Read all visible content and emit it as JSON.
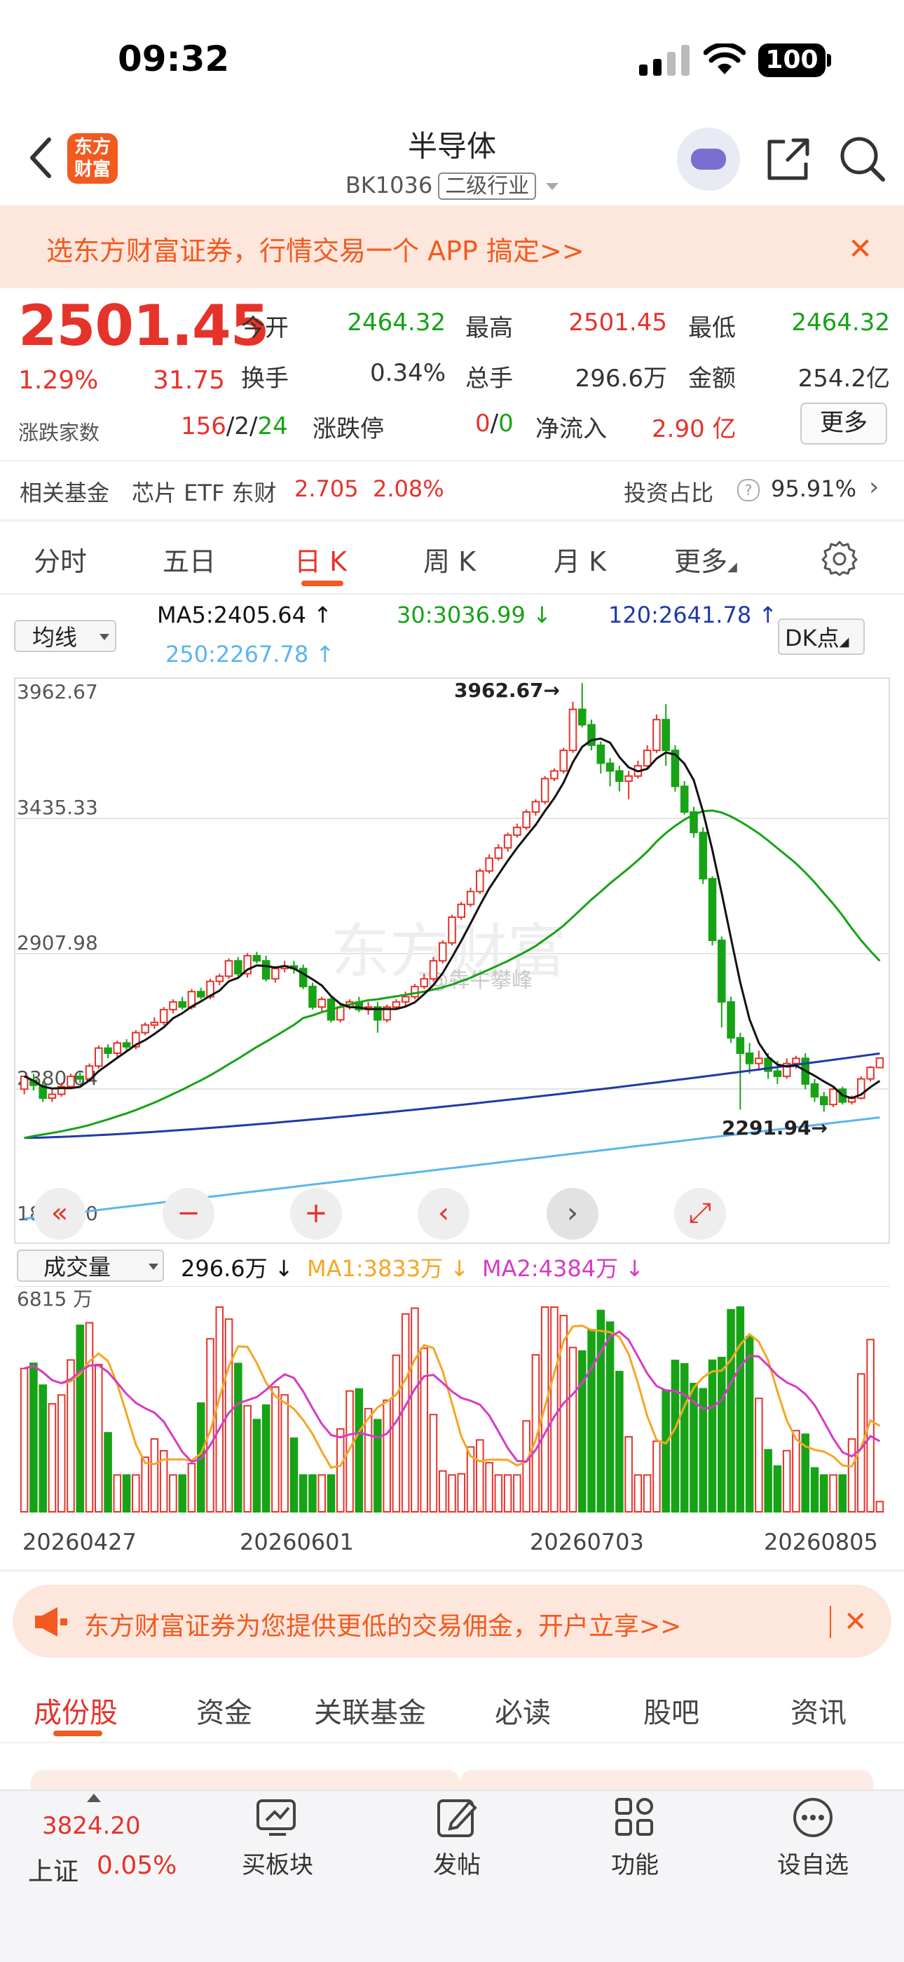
{
  "status_bar": {
    "time": "09:32",
    "battery": "100"
  },
  "header": {
    "title": "半导体",
    "code": "BK1036",
    "tag": "二级行业",
    "logo_text": "东方财富"
  },
  "promo": {
    "text": "选东方财富证券，行情交易一个 APP 搞定>>"
  },
  "quote": {
    "price": "2501.45",
    "change_pct": "1.29%",
    "change": "31.75",
    "open_label": "今开",
    "open": "2464.32",
    "high_label": "最高",
    "high": "2501.45",
    "low_label": "最低",
    "low": "2464.32",
    "turnover_label": "换手",
    "turnover": "0.34%",
    "volume_label": "总手",
    "volume": "296.6万",
    "amount_label": "金额",
    "amount": "254.2亿",
    "breadth_label": "涨跌家数",
    "breadth_up": "156",
    "breadth_flat": "2",
    "breadth_down": "24",
    "limit_label": "涨跌停",
    "limit_up": "0",
    "limit_down": "0",
    "inflow_label": "净流入",
    "inflow": "2.90 亿",
    "more": "更多"
  },
  "fund": {
    "label": "相关基金",
    "name": "芯片 ETF 东财",
    "price": "2.705",
    "pct": "2.08%",
    "ratio_label": "投资占比",
    "ratio": "95.91%"
  },
  "period_tabs": [
    "分时",
    "五日",
    "日 K",
    "周 K",
    "月 K",
    "更多"
  ],
  "ma": {
    "select": "均线",
    "ma5": "MA5:2405.64",
    "ma30": "30:3036.99",
    "ma120": "120:2641.78",
    "ma250": "250:2267.78",
    "dk": "DK点"
  },
  "kchart": {
    "axis_labels": [
      "3962.67",
      "3435.33",
      "2907.98",
      "2380.64",
      "1853.30"
    ],
    "max_label": "3962.67→",
    "min_label": "2291.94→",
    "watermark": "东方财富",
    "weibo_mark": "@犇牛攀峰",
    "controls": [
      "«",
      "−",
      "+",
      "‹",
      "›",
      "⤢"
    ]
  },
  "volume": {
    "select": "成交量",
    "vol": "296.6万",
    "ma1": "MA1:3833万",
    "ma2": "MA2:4384万",
    "top_label": "6815 万",
    "dates": [
      "20260427",
      "20260601",
      "20260703",
      "20260805"
    ]
  },
  "ad": {
    "text": "东方财富证券为您提供更低的交易佣金，开户立享>>"
  },
  "bottom_tabs": [
    "成份股",
    "资金",
    "关联基金",
    "必读",
    "股吧",
    "资讯"
  ],
  "nav": {
    "index_price": "3824.20",
    "index_name": "上证",
    "index_pct": "0.05%",
    "items": [
      "买板块",
      "发帖",
      "功能",
      "设自选"
    ]
  },
  "colors": {
    "up": "#e5332a",
    "down": "#16a316",
    "accent": "#f25a1f"
  },
  "chart_data": {
    "type": "candlestick",
    "dates_shown": [
      "20260427",
      "20260601",
      "20260703",
      "20260805"
    ],
    "ylim": [
      1853.3,
      3962.67
    ],
    "candles": [
      [
        2380,
        2430,
        2360,
        2415
      ],
      [
        2415,
        2395,
        2440,
        2375
      ],
      [
        2395,
        2345,
        2410,
        2330
      ],
      [
        2345,
        2360,
        2380,
        2330
      ],
      [
        2360,
        2390,
        2405,
        2350
      ],
      [
        2390,
        2430,
        2440,
        2380
      ],
      [
        2430,
        2420,
        2445,
        2405
      ],
      [
        2420,
        2470,
        2480,
        2410
      ],
      [
        2470,
        2540,
        2550,
        2460
      ],
      [
        2540,
        2520,
        2555,
        2500
      ],
      [
        2520,
        2560,
        2570,
        2505
      ],
      [
        2560,
        2545,
        2575,
        2530
      ],
      [
        2545,
        2600,
        2610,
        2535
      ],
      [
        2600,
        2630,
        2640,
        2590
      ],
      [
        2630,
        2640,
        2660,
        2615
      ],
      [
        2640,
        2690,
        2700,
        2630
      ],
      [
        2690,
        2720,
        2730,
        2675
      ],
      [
        2720,
        2700,
        2740,
        2690
      ],
      [
        2700,
        2760,
        2770,
        2690
      ],
      [
        2760,
        2740,
        2775,
        2730
      ],
      [
        2740,
        2800,
        2810,
        2730
      ],
      [
        2800,
        2820,
        2830,
        2785
      ],
      [
        2820,
        2880,
        2890,
        2810
      ],
      [
        2880,
        2830,
        2895,
        2820
      ],
      [
        2830,
        2900,
        2910,
        2815
      ],
      [
        2900,
        2880,
        2915,
        2870
      ],
      [
        2880,
        2810,
        2900,
        2800
      ],
      [
        2810,
        2850,
        2860,
        2795
      ],
      [
        2850,
        2860,
        2880,
        2835
      ],
      [
        2860,
        2850,
        2880,
        2830
      ],
      [
        2850,
        2780,
        2865,
        2770
      ],
      [
        2780,
        2700,
        2795,
        2690
      ],
      [
        2700,
        2730,
        2740,
        2680
      ],
      [
        2730,
        2650,
        2745,
        2640
      ],
      [
        2650,
        2700,
        2710,
        2640
      ],
      [
        2700,
        2720,
        2730,
        2690
      ],
      [
        2720,
        2690,
        2740,
        2680
      ],
      [
        2690,
        2700,
        2720,
        2670
      ],
      [
        2700,
        2650,
        2720,
        2600
      ],
      [
        2650,
        2700,
        2710,
        2640
      ],
      [
        2700,
        2720,
        2730,
        2690
      ],
      [
        2720,
        2740,
        2760,
        2700
      ],
      [
        2740,
        2780,
        2790,
        2730
      ],
      [
        2780,
        2810,
        2830,
        2770
      ],
      [
        2810,
        2880,
        2895,
        2800
      ],
      [
        2880,
        2950,
        2960,
        2870
      ],
      [
        2950,
        3050,
        3060,
        2940
      ],
      [
        3050,
        3100,
        3110,
        3040
      ],
      [
        3100,
        3150,
        3165,
        3090
      ],
      [
        3150,
        3230,
        3240,
        3140
      ],
      [
        3230,
        3280,
        3295,
        3220
      ],
      [
        3280,
        3320,
        3335,
        3270
      ],
      [
        3320,
        3370,
        3380,
        3305
      ],
      [
        3370,
        3400,
        3415,
        3360
      ],
      [
        3400,
        3460,
        3470,
        3390
      ],
      [
        3460,
        3500,
        3510,
        3445
      ],
      [
        3500,
        3590,
        3600,
        3490
      ],
      [
        3590,
        3620,
        3630,
        3580
      ],
      [
        3620,
        3700,
        3710,
        3610
      ],
      [
        3700,
        3860,
        3890,
        3690
      ],
      [
        3860,
        3800,
        3962,
        3790
      ],
      [
        3800,
        3720,
        3820,
        3700
      ],
      [
        3720,
        3650,
        3735,
        3610
      ],
      [
        3650,
        3620,
        3670,
        3560
      ],
      [
        3620,
        3580,
        3640,
        3540
      ],
      [
        3580,
        3600,
        3620,
        3510
      ],
      [
        3600,
        3640,
        3660,
        3590
      ],
      [
        3640,
        3700,
        3720,
        3630
      ],
      [
        3700,
        3820,
        3840,
        3690
      ],
      [
        3820,
        3700,
        3880,
        3640
      ],
      [
        3700,
        3560,
        3720,
        3540
      ],
      [
        3560,
        3460,
        3580,
        3450
      ],
      [
        3460,
        3380,
        3480,
        3360
      ],
      [
        3380,
        3200,
        3400,
        3180
      ],
      [
        3200,
        2960,
        3210,
        2940
      ],
      [
        2960,
        2720,
        2975,
        2620
      ],
      [
        2720,
        2580,
        2740,
        2560
      ],
      [
        2580,
        2520,
        2600,
        2300
      ],
      [
        2520,
        2480,
        2560,
        2440
      ],
      [
        2480,
        2500,
        2530,
        2460
      ],
      [
        2500,
        2450,
        2520,
        2420
      ],
      [
        2450,
        2430,
        2490,
        2400
      ],
      [
        2430,
        2480,
        2500,
        2420
      ],
      [
        2480,
        2500,
        2510,
        2460
      ],
      [
        2500,
        2400,
        2520,
        2380
      ],
      [
        2400,
        2350,
        2420,
        2330
      ],
      [
        2350,
        2320,
        2370,
        2292
      ],
      [
        2320,
        2380,
        2390,
        2310
      ],
      [
        2380,
        2330,
        2390,
        2320
      ],
      [
        2330,
        2345,
        2355,
        2320
      ],
      [
        2345,
        2420,
        2430,
        2340
      ],
      [
        2420,
        2465,
        2470,
        2410
      ],
      [
        2464,
        2501,
        2501,
        2464
      ]
    ]
  }
}
